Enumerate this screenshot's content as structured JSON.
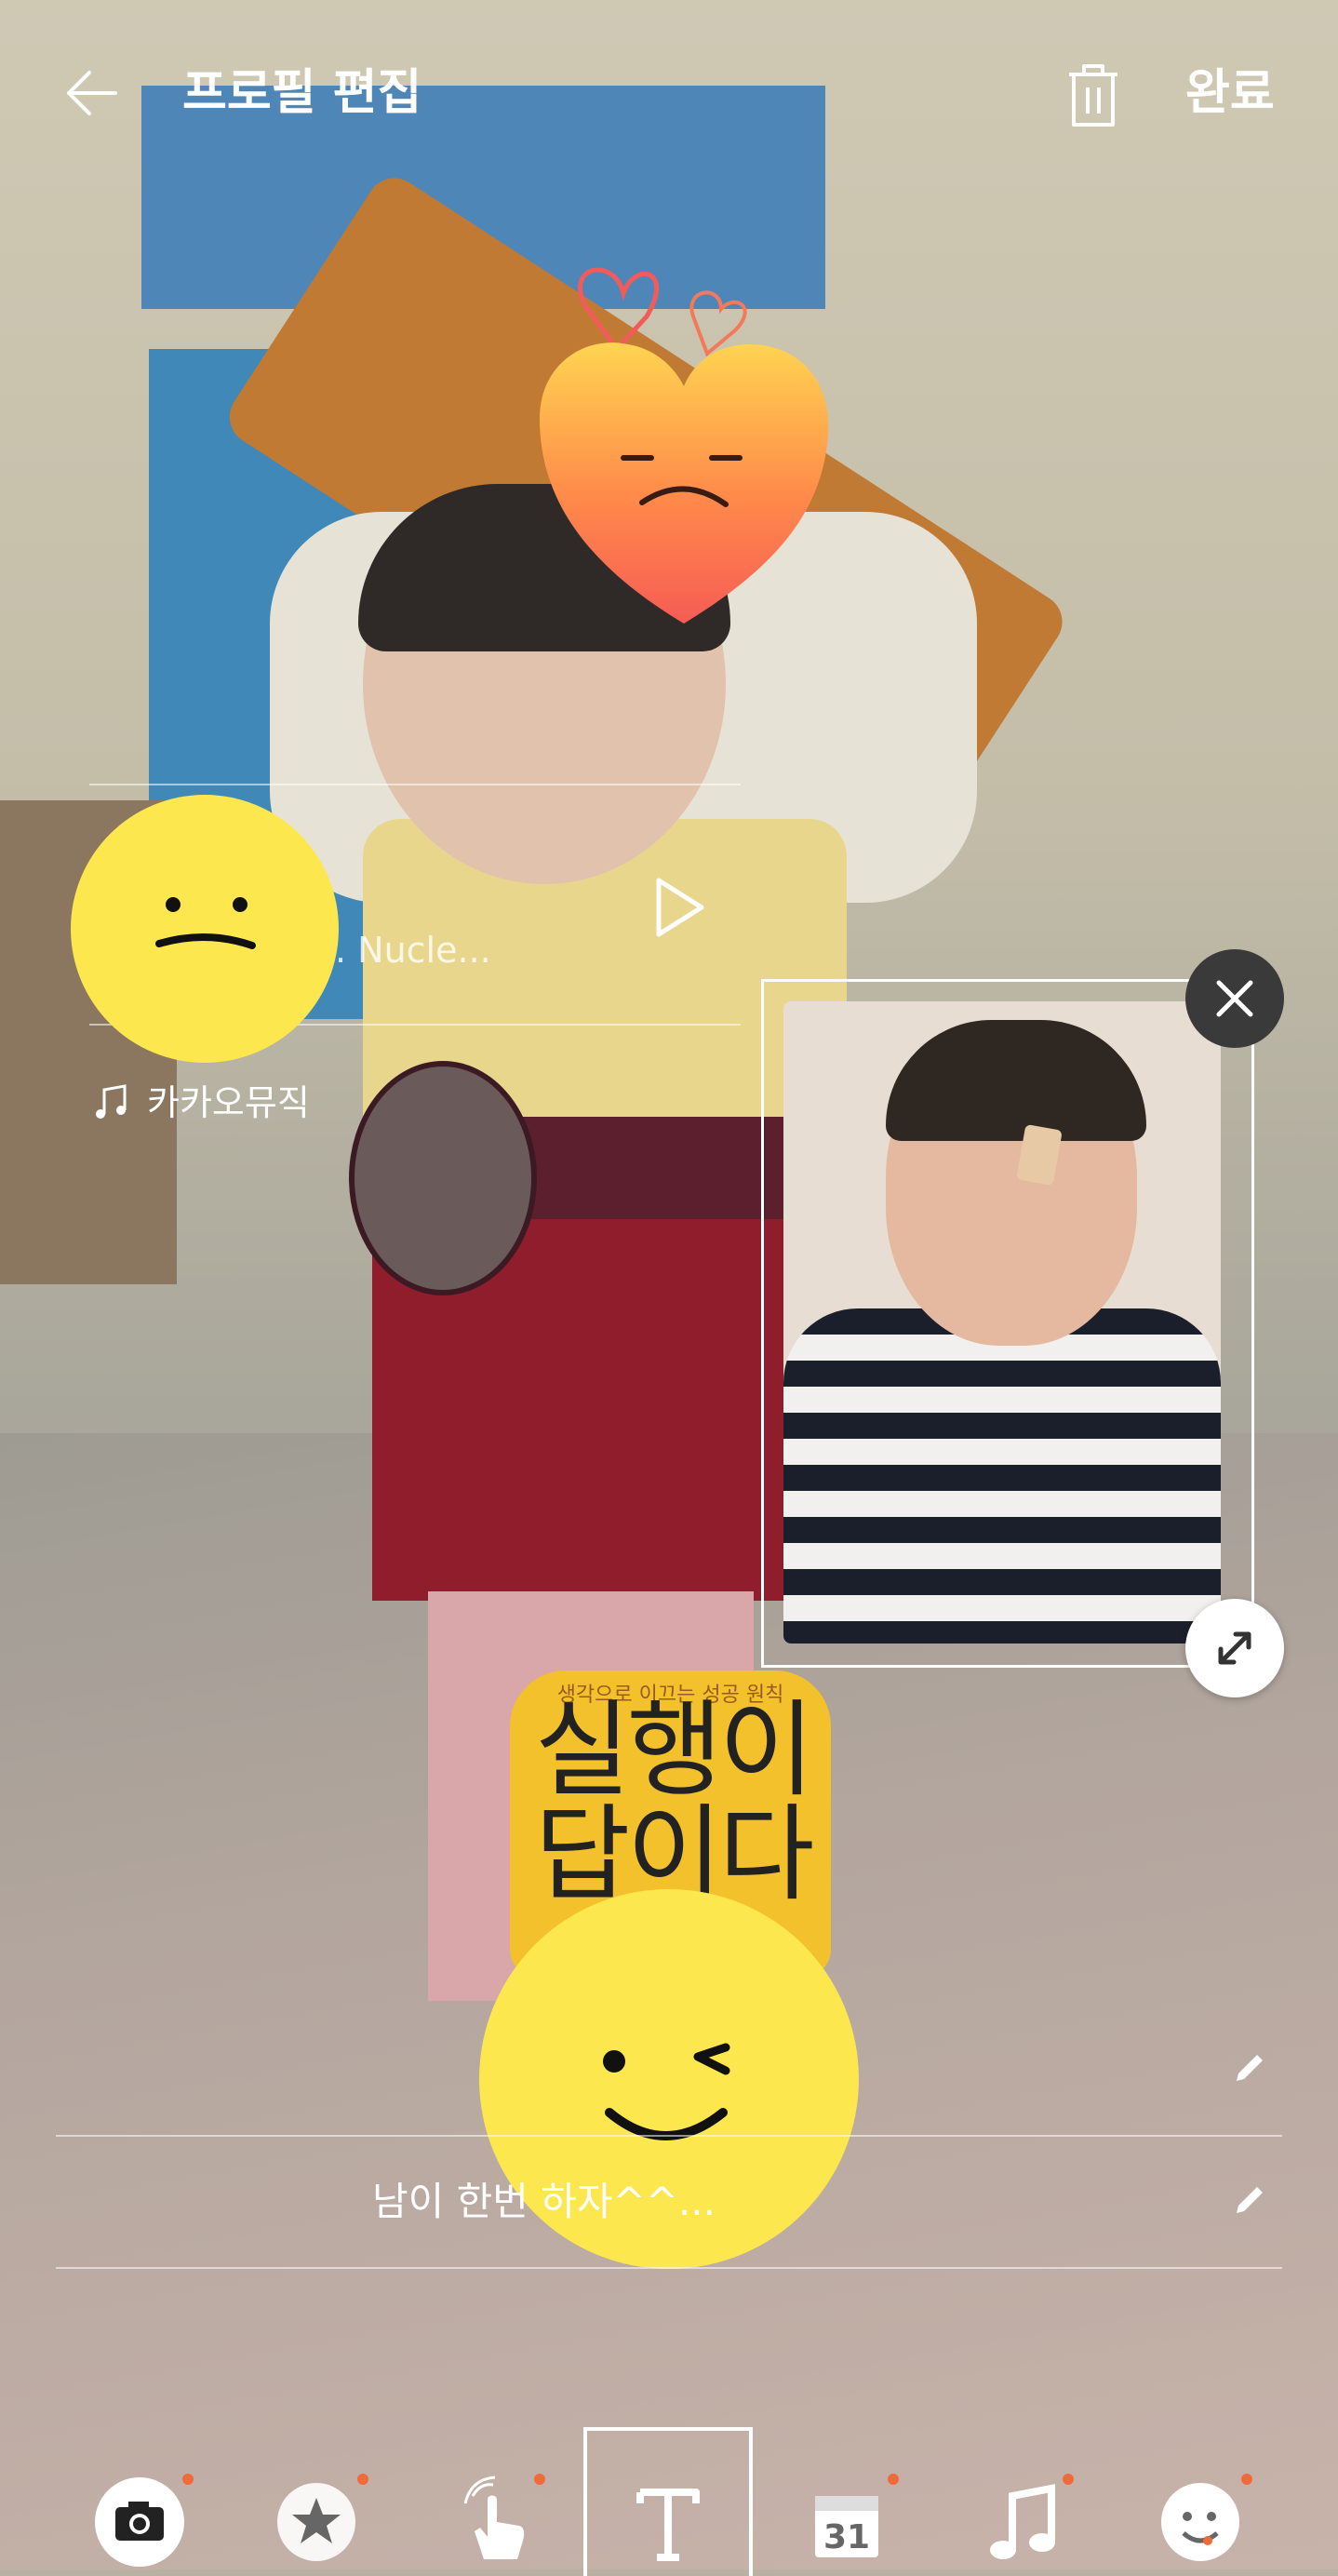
{
  "header": {
    "title": "프로필 편집",
    "done_label": "완료"
  },
  "music": {
    "song_text": ". Nucle...",
    "service_label": "카카오뮤직"
  },
  "book_sticker": {
    "subtitle": "생각으로 이끄는 성공 원칙",
    "title": "실행이 답이다"
  },
  "status": {
    "message": "남이 한번                      하자^^..."
  },
  "toolbar": {
    "items": [
      "camera-icon",
      "sticker-icon",
      "gesture-icon",
      "text-icon",
      "calendar-icon",
      "music-icon",
      "emoticon-icon"
    ],
    "active_item": "text-icon",
    "calendar_day": "31"
  },
  "colors": {
    "accent_dot": "#f06a3a",
    "emoji_yellow": "#fde74f"
  }
}
